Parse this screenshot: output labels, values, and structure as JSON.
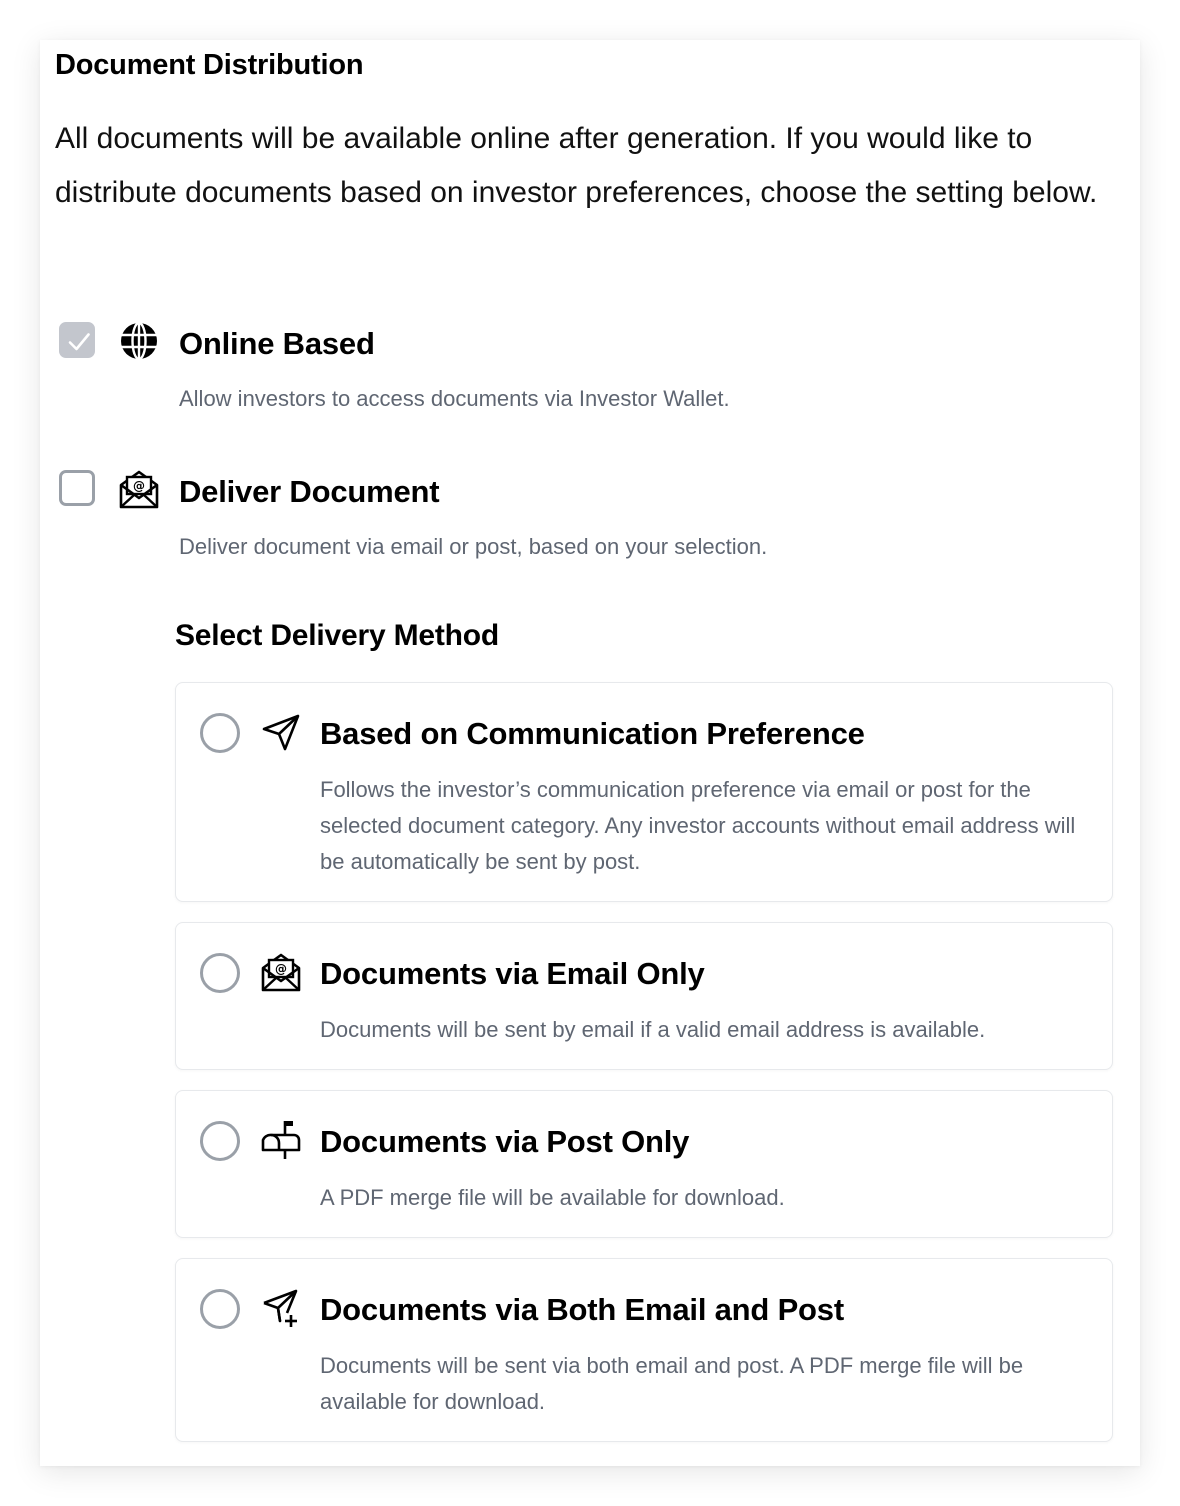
{
  "section": {
    "title": "Document Distribution",
    "intro": "All documents will be available online after generation. If you would like to distribute documents based on investor preferences, choose the setting below."
  },
  "options": [
    {
      "title": "Online Based",
      "description": "Allow investors to access documents via Investor Wallet.",
      "checked": true,
      "icon": "globe-icon"
    },
    {
      "title": "Deliver Document",
      "description": "Deliver document via email or post, based on your selection.",
      "checked": false,
      "icon": "email-envelope-icon"
    }
  ],
  "delivery": {
    "title": "Select Delivery Method",
    "methods": [
      {
        "title": "Based on Communication Preference",
        "description": "Follows the investor’s communication preference via email or post for the selected document category. Any investor accounts without email address will be automatically be sent by post.",
        "icon": "send-icon",
        "selected": false
      },
      {
        "title": "Documents via Email Only",
        "description": "Documents will be sent by email if a valid email address is available.",
        "icon": "email-envelope-icon",
        "selected": false
      },
      {
        "title": "Documents via Post Only",
        "description": "A PDF merge file will be available for download.",
        "icon": "mailbox-icon",
        "selected": false
      },
      {
        "title": "Documents via Both Email and Post",
        "description": "Documents will be sent via both email and post. A PDF merge file will be available for download.",
        "icon": "send-plus-icon",
        "selected": false
      }
    ]
  },
  "colors": {
    "checkbox_checked": "#c3c6cd",
    "checkbox_border": "#9aa0a8",
    "description_text": "#5f6672",
    "card_border": "#e7e9ec"
  }
}
